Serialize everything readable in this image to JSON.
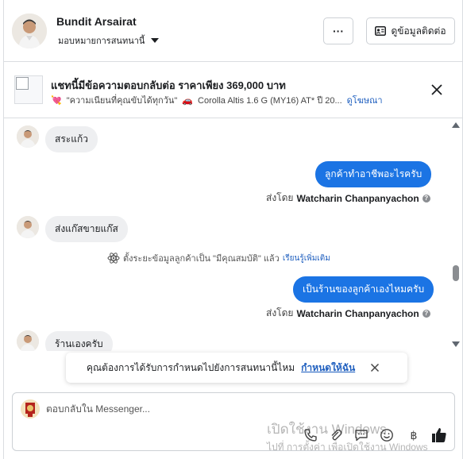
{
  "header": {
    "contact_name": "Bundit Arsairat",
    "assign_label": "มอบหมายการสนทนานี้",
    "more_label": "···",
    "contact_button_label": "ดูข้อมูลติดต่อ"
  },
  "ad": {
    "title": "แชทนี้มีข้อความตอบกลับต่อ ราคาเพียง 369,000 บาท",
    "emoji1": "💘",
    "promo_text": "\"ความเนียนที่คุณขับได้ทุกวัน\"",
    "emoji2": "🚗",
    "car_text": "Corolla Altis 1.6 G (MY16) AT* ปี 20...",
    "link_label": "ดูโฆษณา"
  },
  "messages": {
    "m1": "สระแก้ว",
    "m2": "ลูกค้าทำอาชีพอะไรครับ",
    "m2_sent_prefix": "ส่งโดย",
    "m2_sender": "Watcharin Chanpanyachon",
    "m3": "ส่งแก๊สขายแก๊ส",
    "system_note": "ตั้งระยะข้อมูลลูกค้าเป็น \"มีคุณสมบัติ\" แล้ว",
    "system_link": "เรียนรู้เพิ่มเติม",
    "m4": "เป็นร้านของลูกค้าเองไหมครับ",
    "m4_sent_prefix": "ส่งโดย",
    "m4_sender": "Watcharin Chanpanyachon",
    "m5": "ร้านเองครับ"
  },
  "toast": {
    "text": "คุณต้องการได้รับการกำหนดไปยังการสนทนานี้ไหม",
    "link": "กำหนดให้ฉัน"
  },
  "composer": {
    "placeholder": "ตอบกลับใน Messenger..."
  },
  "watermark": {
    "line1": "เปิดใช้งาน Windows",
    "line2": "ไปที่ การตั้งค่า เพื่อเปิดใช้งาน Windows"
  },
  "colors": {
    "outgoing_bubble": "#1b74e4",
    "incoming_bubble": "#eeeff1",
    "link": "#1f5fbf"
  },
  "icons": [
    "more-icon",
    "contact-card-icon",
    "close-icon",
    "info-icon",
    "atom-icon",
    "phone-icon",
    "paperclip-icon",
    "chat-icon",
    "emoji-icon",
    "baht-icon",
    "like-icon"
  ]
}
